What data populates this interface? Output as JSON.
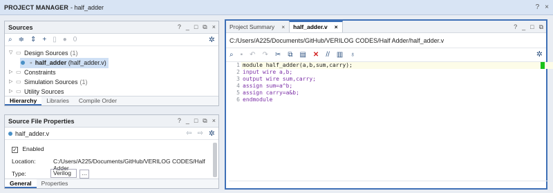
{
  "title": {
    "main": "PROJECT MANAGER",
    "sub": "- half_adder",
    "help": "?",
    "close": "×"
  },
  "sources": {
    "title": "Sources",
    "controls": [
      "?",
      "_",
      "□",
      "⧉",
      "×"
    ],
    "count_label": "0",
    "tree": [
      {
        "label": "Design Sources",
        "count": "(1)"
      },
      {
        "label": "half_adder",
        "file": "(half_adder.v)"
      },
      {
        "label": "Constraints",
        "count": ""
      },
      {
        "label": "Simulation Sources",
        "count": "(1)"
      },
      {
        "label": "Utility Sources",
        "count": ""
      }
    ],
    "tabs": [
      "Hierarchy",
      "Libraries",
      "Compile Order"
    ]
  },
  "properties": {
    "title": "Source File Properties",
    "controls": [
      "?",
      "_",
      "□",
      "⧉",
      "×"
    ],
    "file": "half_adder.v",
    "enabled_label": "Enabled",
    "location_label": "Location:",
    "location_value": "C:/Users/A225/Documents/GitHub/VERILOG CODES/Half Adder",
    "type_label": "Type:",
    "type_value": "Verilog",
    "tabs": [
      "General",
      "Properties"
    ]
  },
  "editor": {
    "tabs": [
      {
        "label": "Project Summary",
        "close": "×"
      },
      {
        "label": "half_adder.v",
        "close": "×"
      }
    ],
    "controls": [
      "?",
      "_",
      "□",
      "⧉"
    ],
    "path": "C:/Users/A225/Documents/GitHub/VERILOG CODES/Half Adder/half_adder.v",
    "lines": [
      {
        "n": "1",
        "code": "module half_adder(a,b,sum,carry);"
      },
      {
        "n": "2",
        "code": "input wire a,b;"
      },
      {
        "n": "3",
        "code": "output wire sum,carry;"
      },
      {
        "n": "4",
        "code": "assign sum=a^b;"
      },
      {
        "n": "5",
        "code": "assign carry=a&b;"
      },
      {
        "n": "6",
        "code": "endmodule"
      }
    ]
  },
  "colors": {
    "accent": "#3d6fb6",
    "keyword": "#7b2fa6",
    "marker": "#19c219"
  }
}
